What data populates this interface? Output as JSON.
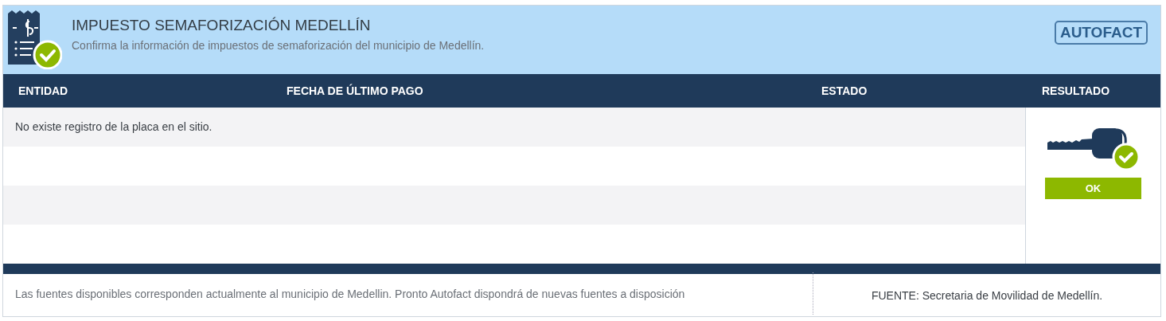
{
  "header": {
    "title": "IMPUESTO SEMAFORIZACIÓN MEDELLÍN",
    "subtitle": "Confirma la información de impuestos de semaforización del municipio de Medellín.",
    "logo": "AUTOFACT"
  },
  "table": {
    "columns": [
      "ENTIDAD",
      "FECHA DE ÚLTIMO PAGO",
      "ESTADO",
      "RESULTADO"
    ],
    "message": "No existe registro de la placa en el sitio.",
    "result": {
      "label": "OK",
      "kind": "ok"
    }
  },
  "footer": {
    "note": "Las fuentes disponibles corresponden actualmente al municipio de Medellin. Pronto Autofact dispondrá de nuevas fuentes a disposición",
    "source": "FUENTE: Secretaria de Movilidad de Medellín."
  }
}
